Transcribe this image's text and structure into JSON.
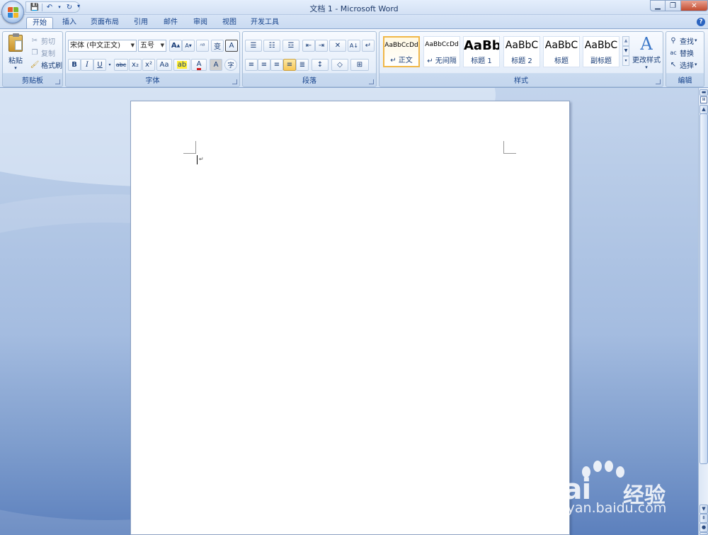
{
  "window": {
    "title": "文档 1 - Microsoft Word",
    "controls": {
      "minimize": "▁",
      "restore": "❐",
      "close": "✕"
    }
  },
  "qat": {
    "save_icon": "💾",
    "undo_icon": "↶",
    "redo_icon": "↻",
    "more_icon": "▾"
  },
  "tabs": [
    {
      "label": "开始",
      "active": true
    },
    {
      "label": "插入"
    },
    {
      "label": "页面布局"
    },
    {
      "label": "引用"
    },
    {
      "label": "邮件"
    },
    {
      "label": "审阅"
    },
    {
      "label": "视图"
    },
    {
      "label": "开发工具"
    }
  ],
  "help": "?",
  "clipboard": {
    "label": "剪贴板",
    "paste": "粘贴",
    "cut": "剪切",
    "copy": "复制",
    "format_painter": "格式刷"
  },
  "font": {
    "label": "字体",
    "name": "宋体 (中文正文)",
    "size": "五号",
    "grow": "A",
    "shrink": "A",
    "clear": "ᴬᴮ",
    "phonetic": "变",
    "char_border": "A",
    "bold": "B",
    "italic": "I",
    "underline": "U",
    "strike": "abc",
    "subscript": "x₂",
    "superscript": "x²",
    "change_case": "Aa",
    "highlight": "ab",
    "font_color": "A",
    "char_shading": "A",
    "enclose": "字"
  },
  "paragraph": {
    "label": "段落",
    "bullets": "☰",
    "numbering": "☷",
    "multilevel": "☲",
    "decrease_indent": "⇤",
    "increase_indent": "⇥",
    "chinese_layout": "✕",
    "sort": "A↓",
    "show_marks": "↵",
    "align_left": "≡",
    "center": "≡",
    "align_right": "≡",
    "justify": "≡",
    "distribute": "≣",
    "line_spacing": "↕",
    "shading": "◇",
    "borders": "⊞"
  },
  "styles": {
    "label": "样式",
    "items": [
      {
        "sample": "AaBbCcDd",
        "name": "↵ 正文",
        "selected": true
      },
      {
        "sample": "AaBbCcDd",
        "name": "↵ 无间隔"
      },
      {
        "sample": "AaBb",
        "name": "标题 1"
      },
      {
        "sample": "AaBbC",
        "name": "标题 2"
      },
      {
        "sample": "AaBbC",
        "name": "标题"
      },
      {
        "sample": "AaBbC",
        "name": "副标题"
      }
    ],
    "change_styles": "更改样式"
  },
  "editing": {
    "label": "编辑",
    "find": "查找",
    "replace": "替换",
    "select": "选择"
  },
  "document": {
    "para_mark": "↵"
  },
  "watermark": {
    "brand": "Bai",
    "brand2": "经验",
    "url": "jingyan.baidu.com"
  },
  "colors": {
    "accent": "#15428b",
    "ribbon": "#dfe9f7",
    "workspace": "#a4bce0"
  }
}
